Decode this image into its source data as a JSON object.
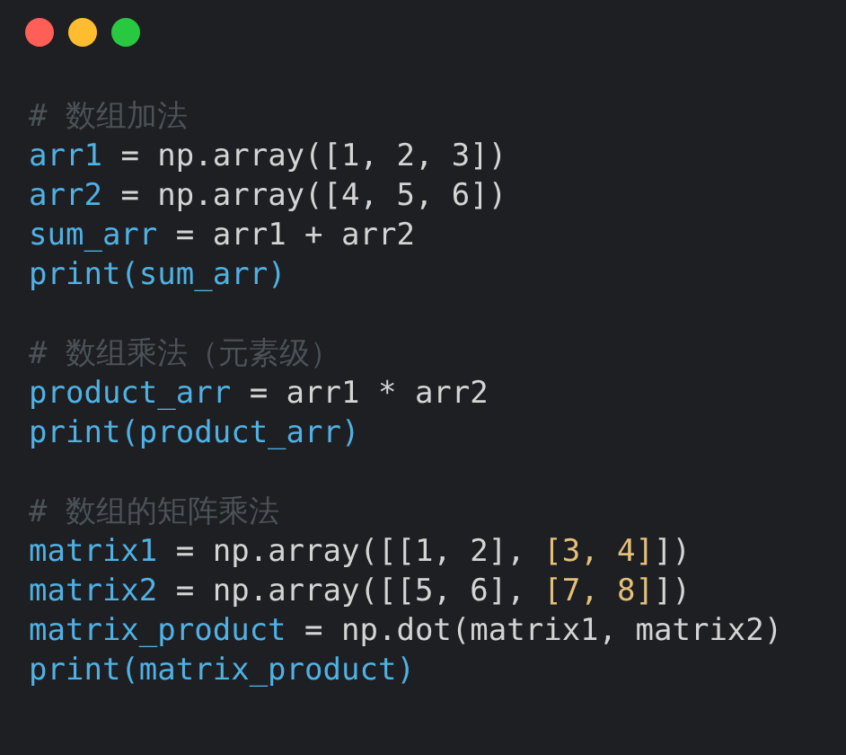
{
  "window_controls": [
    {
      "kind": "close"
    },
    {
      "kind": "minimize"
    },
    {
      "kind": "maximize"
    }
  ],
  "code_blocks": [
    {
      "lines": [
        {
          "tokens": [
            {
              "kind": "comment",
              "text": "# 数组加法"
            }
          ]
        },
        {
          "tokens": [
            {
              "kind": "name",
              "text": "arr1"
            },
            {
              "kind": "plain",
              "text": " = np.array([1, 2, 3])"
            }
          ]
        },
        {
          "tokens": [
            {
              "kind": "name",
              "text": "arr2"
            },
            {
              "kind": "plain",
              "text": " = np.array([4, 5, 6])"
            }
          ]
        },
        {
          "tokens": [
            {
              "kind": "name",
              "text": "sum_arr"
            },
            {
              "kind": "plain",
              "text": " = arr1 + arr2"
            }
          ]
        },
        {
          "tokens": [
            {
              "kind": "name",
              "text": "print(sum_arr)"
            }
          ]
        }
      ]
    },
    {
      "lines": [
        {
          "tokens": [
            {
              "kind": "comment",
              "text": "# 数组乘法（元素级）"
            }
          ]
        },
        {
          "tokens": [
            {
              "kind": "name",
              "text": "product_arr"
            },
            {
              "kind": "plain",
              "text": " = arr1 * arr2"
            }
          ]
        },
        {
          "tokens": [
            {
              "kind": "name",
              "text": "print(product_arr)"
            }
          ]
        }
      ]
    },
    {
      "lines": [
        {
          "tokens": [
            {
              "kind": "comment",
              "text": "# 数组的矩阵乘法"
            }
          ]
        },
        {
          "tokens": [
            {
              "kind": "name",
              "text": "matrix1"
            },
            {
              "kind": "plain",
              "text": " = np.array([[1, 2], "
            },
            {
              "kind": "nested",
              "text": "[3, 4]"
            },
            {
              "kind": "plain",
              "text": "])"
            }
          ]
        },
        {
          "tokens": [
            {
              "kind": "name",
              "text": "matrix2"
            },
            {
              "kind": "plain",
              "text": " = np.array([[5, 6], "
            },
            {
              "kind": "nested",
              "text": "[7, 8]"
            },
            {
              "kind": "plain",
              "text": "])"
            }
          ]
        },
        {
          "tokens": [
            {
              "kind": "name",
              "text": "matrix_product"
            },
            {
              "kind": "plain",
              "text": " = np.dot(matrix1, matrix2)"
            }
          ]
        },
        {
          "tokens": [
            {
              "kind": "name",
              "text": "print(matrix_product)"
            }
          ]
        }
      ]
    }
  ]
}
